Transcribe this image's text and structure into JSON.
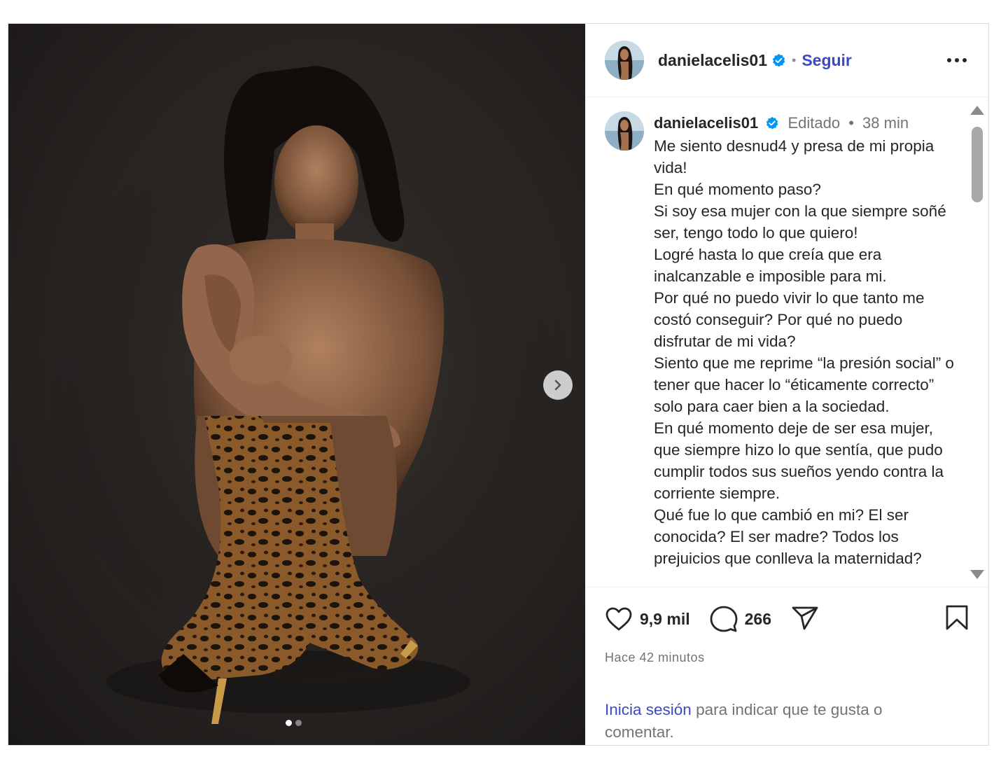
{
  "post": {
    "username": "danielacelis01",
    "follow_label": "Seguir",
    "separator": "•",
    "caption": {
      "username": "danielacelis01",
      "edited_label": "Editado",
      "separator": "•",
      "time": "38 min",
      "lines": [
        "Me siento desnud4 y presa de mi propia vida!",
        "En qué momento paso?",
        "Si soy esa mujer con la que siempre soñé ser, tengo todo lo que quiero!",
        "Logré hasta lo que creía que era inalcanzable e imposible para mi.",
        "Por qué no puedo vivir lo que tanto me costó conseguir? Por qué no puedo disfrutar de mi vida?",
        "Siento que me reprime “la presión social” o tener que hacer lo “éticamente correcto” solo para caer bien a la sociedad.",
        "En qué momento deje de ser esa mujer, que siempre hizo lo que sentía, que pudo cumplir todos sus sueños yendo contra la corriente siempre.",
        "Qué fue lo que cambió en mi? El ser conocida? El ser madre? Todos los prejuicios que conlleva la maternidad?"
      ]
    },
    "likes": "9,9 mil",
    "comments": "266",
    "time_ago": "Hace 42 minutos",
    "login_link": "Inicia sesión",
    "login_text": "para indicar que te gusta o comentar.",
    "carousel": {
      "current": 1,
      "total": 2
    }
  },
  "icons": {
    "verified": "verified-badge-icon",
    "more": "more-options-icon",
    "next": "chevron-right-icon",
    "like": "heart-icon",
    "comment": "comment-icon",
    "share": "share-icon",
    "save": "bookmark-icon"
  },
  "colors": {
    "link": "#3b49c4",
    "verified": "#0095f6",
    "muted": "#737373"
  }
}
